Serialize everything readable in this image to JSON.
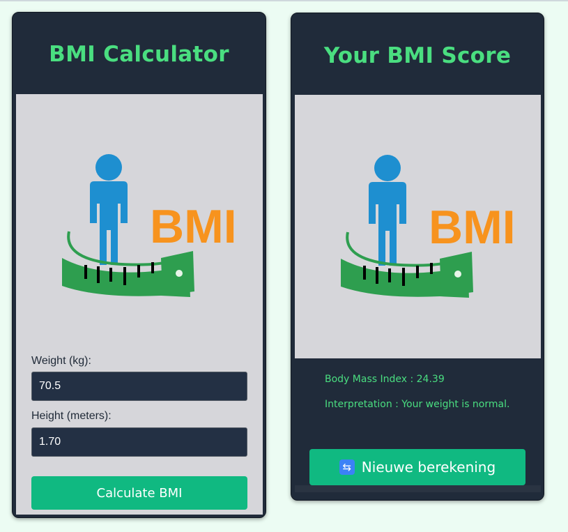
{
  "colors": {
    "page_bg": "#ecfcf3",
    "card_bg": "#202b3a",
    "panel_bg": "#d6d6da",
    "accent_green": "#4ade80",
    "button_bg": "#10b981",
    "input_bg": "#233044",
    "input_text": "#ffffff",
    "label_text": "#1f2937",
    "result_text": "#4ade80",
    "logo_person": "#1e8fd0",
    "logo_text": "#f7931e",
    "logo_tape": "#2e9e4f",
    "icon_bg": "#3b82f6"
  },
  "calculator": {
    "title": "BMI Calculator",
    "logo_icon": "bmi-logo-icon",
    "logo_text": "BMI",
    "weight": {
      "label": "Weight (kg):",
      "value": "70.5"
    },
    "height": {
      "label": "Height (meters):",
      "value": "1.70"
    },
    "calculate_label": "Calculate BMI"
  },
  "result": {
    "title": "Your BMI Score",
    "logo_icon": "bmi-logo-icon",
    "logo_text": "BMI",
    "bmi_line": "Body Mass Index : 24.39",
    "interpretation_line": "Interpretation : Your weight is normal.",
    "recalc_icon": "repeat-icon",
    "recalc_label": "Nieuwe berekening"
  }
}
